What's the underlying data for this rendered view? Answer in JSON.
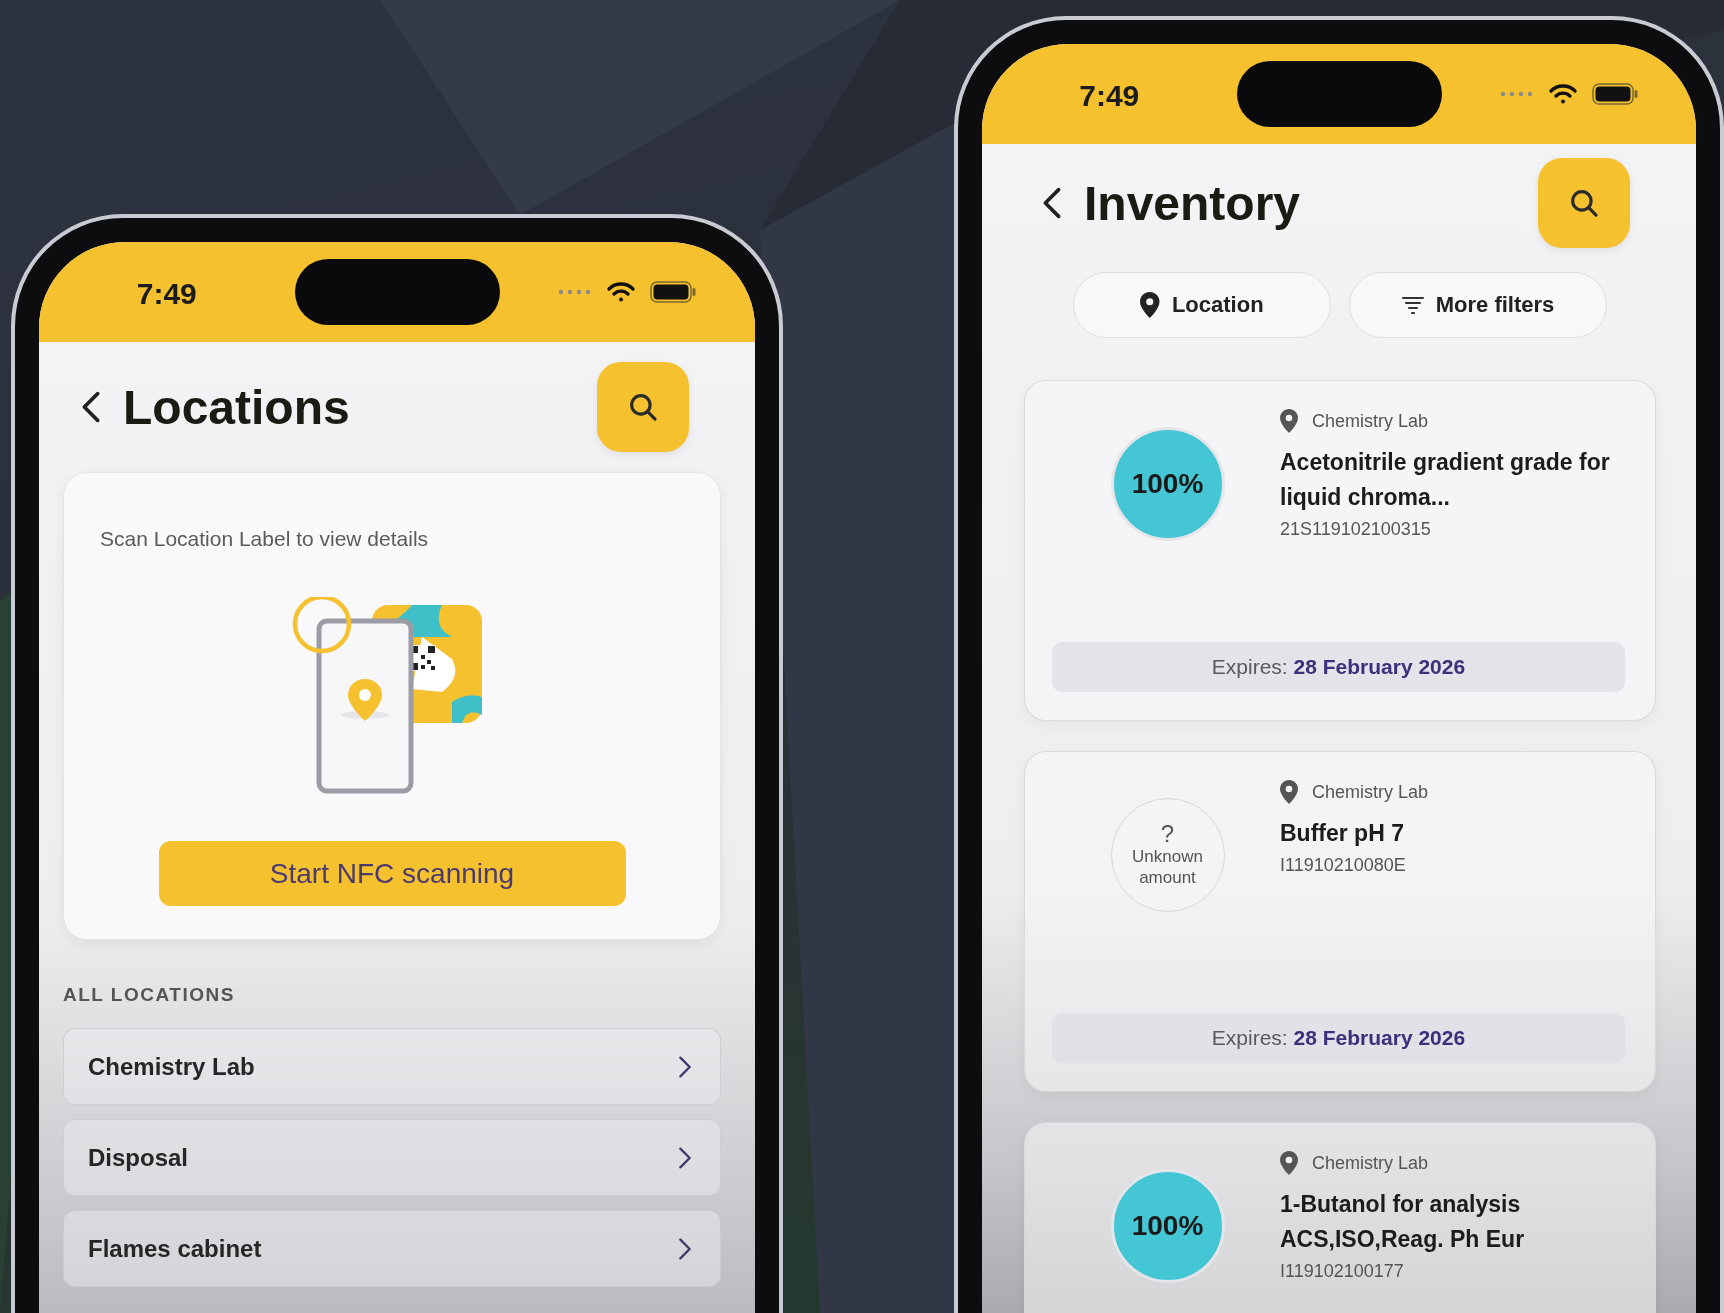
{
  "phones": [
    {
      "kind": "locations",
      "status_bar": {
        "time": "7:49"
      },
      "title": "Locations",
      "scan_card": {
        "prompt": "Scan Location Label to view details",
        "button": "Start NFC scanning"
      },
      "section_heading": "ALL LOCATIONS",
      "locations": [
        "Chemistry Lab",
        "Disposal",
        "Flames cabinet"
      ]
    },
    {
      "kind": "inventory",
      "status_bar": {
        "time": "7:49"
      },
      "title": "Inventory",
      "filters": [
        {
          "kind": "location",
          "label": "Location"
        },
        {
          "kind": "filters",
          "label": "More filters"
        }
      ],
      "items": [
        {
          "location": "Chemistry Lab",
          "name": "Acetonitrile gradient grade for liquid chroma...",
          "code": "21S119102100315",
          "amount": {
            "kind": "percent",
            "text": "100%"
          },
          "expires_label": "Expires:",
          "expires_date": "28 February 2026"
        },
        {
          "location": "Chemistry Lab",
          "name": "Buffer pH 7",
          "code": "I11910210080E",
          "amount": {
            "kind": "unknown",
            "mark": "?",
            "text": "Unknown amount"
          },
          "expires_label": "Expires:",
          "expires_date": "28 February 2026"
        },
        {
          "location": "Chemistry Lab",
          "name": "1-Butanol for analysis ACS,ISO,Reag. Ph Eur",
          "code": "I119102100177",
          "amount": {
            "kind": "percent",
            "text": "100%"
          }
        }
      ]
    }
  ]
}
